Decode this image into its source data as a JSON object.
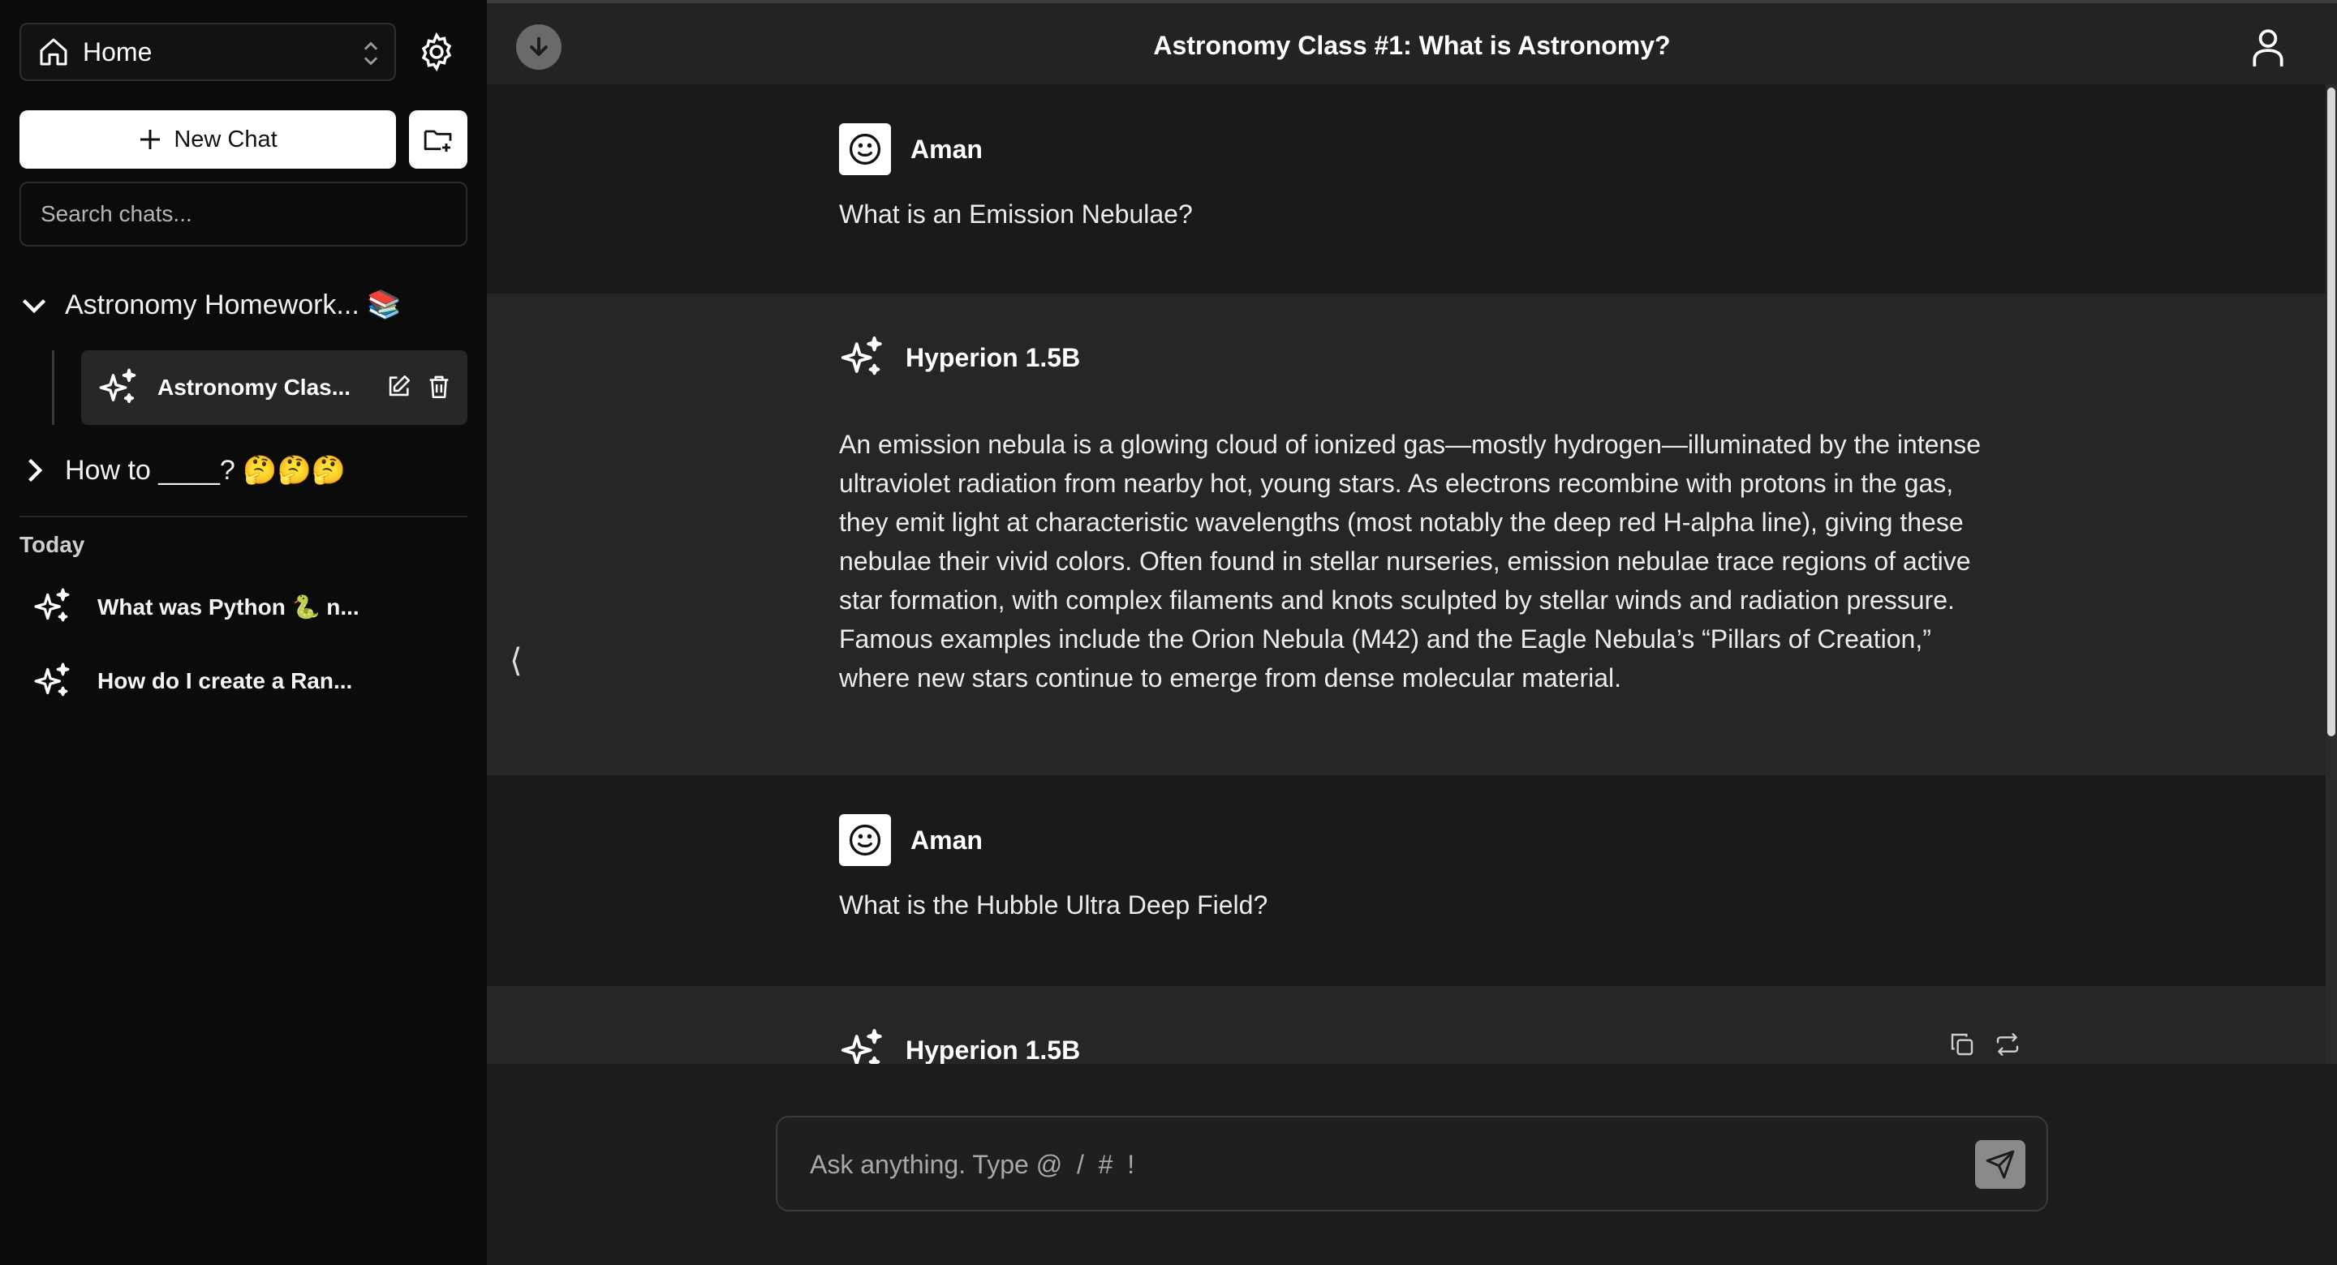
{
  "sidebar": {
    "workspace_label": "Home",
    "new_chat_label": "New Chat",
    "search_placeholder": "Search chats...",
    "folders": [
      {
        "label": "Astronomy Homework... 📚",
        "expanded": true
      },
      {
        "label": "How to ____? 🤔🤔🤔",
        "expanded": false
      }
    ],
    "active_chat": "Astronomy Clas...",
    "section_today": "Today",
    "today_chats": [
      {
        "label": "What was Python 🐍 n..."
      },
      {
        "label": "How do I create a Ran..."
      }
    ]
  },
  "main": {
    "title": "Astronomy Class #1: What is Astronomy?",
    "messages": [
      {
        "role": "user",
        "author": "Aman",
        "text": "What is an Emission Nebulae?"
      },
      {
        "role": "ai",
        "author": "Hyperion 1.5B",
        "text": "An emission nebula is a glowing cloud of ionized gas—mostly hydrogen—illuminated by the intense ultraviolet radiation from nearby hot, young stars. As electrons recombine with protons in the gas, they emit light at characteristic wavelengths (most notably the deep red H-alpha line), giving these nebulae their vivid colors. Often found in stellar nurseries, emission nebulae trace regions of active star formation, with complex filaments and knots sculpted by stellar winds and radiation pressure. Famous examples include the Orion Nebula (M42) and the Eagle Nebula’s “Pillars of Creation,” where new stars continue to emerge from dense molecular material."
      },
      {
        "role": "user",
        "author": "Aman",
        "text": "What is the Hubble Ultra Deep Field?"
      },
      {
        "role": "ai",
        "author": "Hyperion 1.5B",
        "text": ""
      }
    ],
    "collapse_glyph": "⟨",
    "composer_placeholder": "Ask anything. Type @  /  #  !"
  },
  "colors": {
    "sidebar_bg": "#0b0b0b",
    "main_bg": "#1c1c1c",
    "ai_msg_bg": "#262626",
    "topbar_bg": "#232323"
  }
}
